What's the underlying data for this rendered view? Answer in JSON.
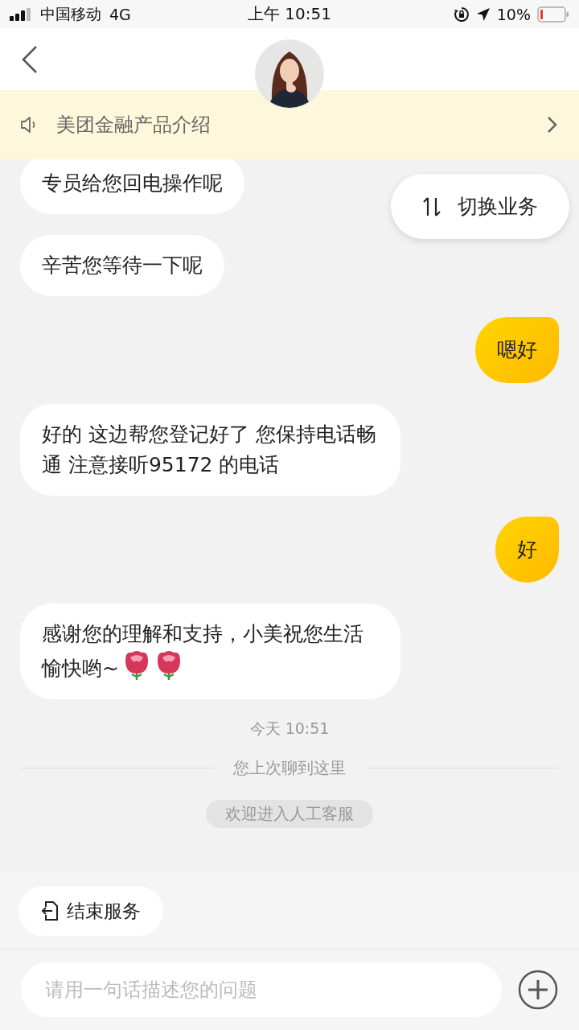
{
  "status_bar": {
    "carrier": "中国移动",
    "network": "4G",
    "time": "上午 10:51",
    "battery": "10%"
  },
  "notice": {
    "text": "美团金融产品介绍"
  },
  "switch_button": {
    "label": "切换业务"
  },
  "messages": [
    {
      "kind": "agent",
      "text": "专员给您回电操作呢"
    },
    {
      "kind": "agent",
      "text": "辛苦您等待一下呢"
    },
    {
      "kind": "user",
      "text": "嗯好"
    },
    {
      "kind": "agent",
      "text": "好的 这边帮您登记好了 您保持电话畅通 注意接听95172 的电话"
    },
    {
      "kind": "user",
      "text": "好"
    },
    {
      "kind": "agent",
      "text": "感谢您的理解和支持，小美祝您生活愉快哟~",
      "stickers": [
        {
          "kind": "rose"
        },
        {
          "kind": "rose"
        }
      ]
    },
    {
      "kind": "time",
      "text": "今天 10:51"
    },
    {
      "kind": "divider",
      "text": "您上次聊到这里"
    },
    {
      "kind": "system",
      "text": "欢迎进入人工客服"
    }
  ],
  "end_button": {
    "label": "结束服务"
  },
  "input": {
    "placeholder": "请用一句话描述您的问题"
  }
}
